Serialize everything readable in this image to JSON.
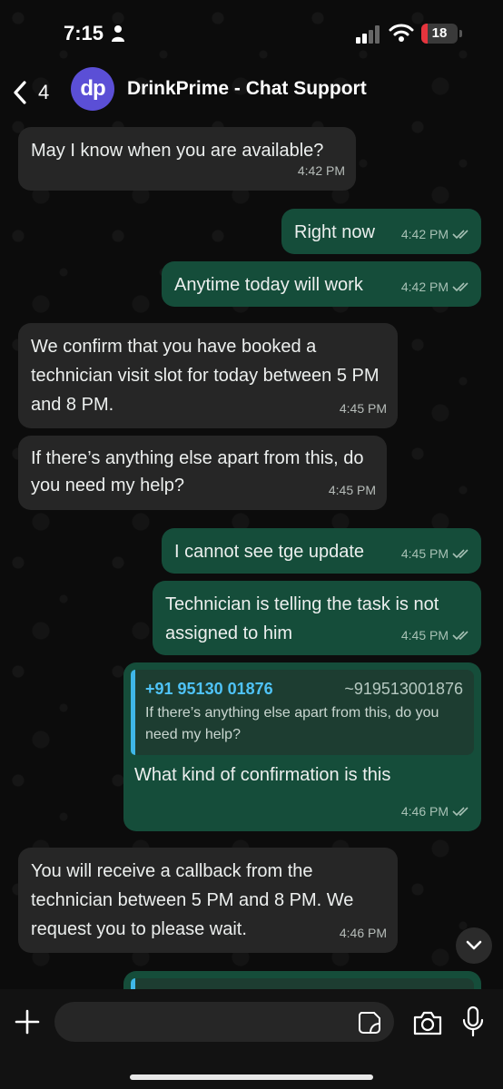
{
  "status_bar": {
    "time": "7:15",
    "battery_level": 18,
    "battery_label": "18"
  },
  "header": {
    "back_count": "4",
    "avatar_initials": "dp",
    "title": "DrinkPrime - Chat Support"
  },
  "messages": [
    {
      "direction": "in",
      "text": "May I know when you are available?",
      "time": "4:42 PM"
    },
    {
      "direction": "out",
      "text": "Right now",
      "time": "4:42 PM"
    },
    {
      "direction": "out",
      "text": "Anytime today will work",
      "time": "4:42 PM"
    },
    {
      "direction": "in",
      "text": "We confirm that you have booked a technician visit slot for today between 5 PM and 8 PM.",
      "time": "4:45 PM"
    },
    {
      "direction": "in",
      "text": "If there’s anything else apart from this, do you need my help?",
      "time": "4:45 PM"
    },
    {
      "direction": "out",
      "text": "I cannot see tge update",
      "time": "4:45 PM"
    },
    {
      "direction": "out",
      "text": "Technician is telling the task is not assigned to him",
      "time": "4:45 PM"
    },
    {
      "direction": "out",
      "quote": {
        "name": "+91 95130 01876",
        "number": "~919513001876",
        "text": "If there’s anything else apart from this, do you need my help?"
      },
      "text": "What kind of confirmation is this",
      "time": "4:46 PM"
    },
    {
      "direction": "in",
      "text": "You will receive a callback from the technician between 5 PM and 8 PM. We request you to please wait.",
      "time": "4:46 PM"
    }
  ],
  "composer": {
    "placeholder": "",
    "value": ""
  },
  "icons": {
    "back": "chevron-left-icon",
    "person": "person-icon",
    "signal": "signal-icon",
    "wifi": "wifi-icon",
    "ticks": "double-check-icon",
    "scroll": "chevron-down-icon",
    "plus": "plus-icon",
    "sticker": "sticker-icon",
    "camera": "camera-icon",
    "mic": "microphone-icon"
  },
  "colors": {
    "incoming_bubble": "#262626",
    "outgoing_bubble": "#154d3a",
    "avatar": "#5b4fd6",
    "quote_name": "#4fc3f7",
    "battery": "#e5343d"
  }
}
